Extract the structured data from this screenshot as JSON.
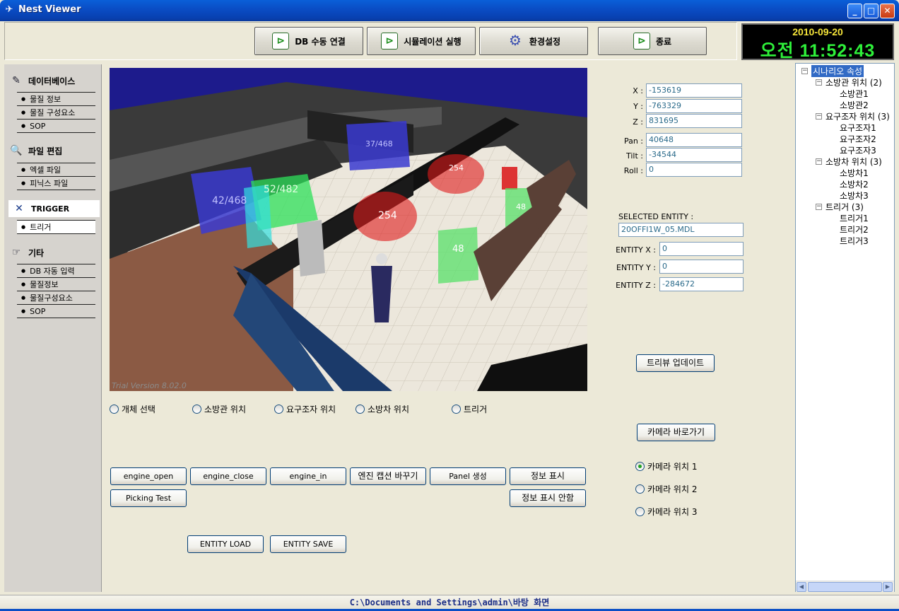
{
  "window": {
    "title": "Nest Viewer",
    "minimize": "_",
    "maximize": "□",
    "close": "✕"
  },
  "toolbar": {
    "db_connect": "DB 수동 연결",
    "run_sim": "시뮬레이션 실행",
    "settings": "환경설정",
    "exit": "종료",
    "icon_glyph": "⊳"
  },
  "clock": {
    "date": "2010-09-20",
    "time": "오전 11:52:43"
  },
  "sidebar": {
    "sections": [
      {
        "title": "데이터베이스",
        "items": [
          "물질 정보",
          "물질 구성요소",
          "SOP"
        ]
      },
      {
        "title": "파일 편집",
        "items": [
          "엑셀 파일",
          "피닉스 파일"
        ]
      },
      {
        "title": "TRIGGER",
        "items": [
          "트리거"
        ]
      },
      {
        "title": "기타",
        "items": [
          "DB 자동 입력",
          "물질정보",
          "물질구성요소",
          "SOP"
        ]
      }
    ]
  },
  "viewport": {
    "watermark": "Trial Version 8.02.0",
    "labels": [
      "42/468",
      "52/482",
      "37/468",
      "254",
      "254",
      "48",
      "48"
    ]
  },
  "radios": [
    "개체 선택",
    "소방관 위치",
    "요구조자 위치",
    "소방차 위치",
    "트리거"
  ],
  "buttons": {
    "engine_open": "engine_open",
    "engine_close": "engine_close",
    "engine_in": "engine_in",
    "engine_caption": "엔진 캡션 바꾸기",
    "panel_create": "Panel 생성",
    "info_show": "정보 표시",
    "picking_test": "Picking Test",
    "info_hide": "정보 표시 안함",
    "entity_load": "ENTITY LOAD",
    "entity_save": "ENTITY SAVE",
    "tree_update": "트리뷰 업데이트",
    "camera_go": "카메라 바로가기"
  },
  "coords": {
    "x_label": "X :",
    "x": "-153619",
    "y_label": "Y :",
    "y": "-763329",
    "z_label": "Z :",
    "z": "831695",
    "pan_label": "Pan :",
    "pan": "40648",
    "tilt_label": "Tilt :",
    "tilt": "-34544",
    "roll_label": "Roll :",
    "roll": "0"
  },
  "entity": {
    "selected_label": "SELECTED ENTITY :",
    "selected": "20OFFI1W_05.MDL",
    "x_label": "ENTITY X :",
    "x": "0",
    "y_label": "ENTITY Y :",
    "y": "0",
    "z_label": "ENTITY Z :",
    "z": "-284672"
  },
  "camera_radios": [
    "카메라 위치 1",
    "카메라 위치 2",
    "카메라 위치 3"
  ],
  "tree": {
    "root": "시나리오 속성",
    "groups": [
      {
        "label": "소방관 위치 (2)",
        "children": [
          "소방관1",
          "소방관2"
        ]
      },
      {
        "label": "요구조자 위치 (3)",
        "children": [
          "요구조자1",
          "요구조자2",
          "요구조자3"
        ]
      },
      {
        "label": "소방차 위치 (3)",
        "children": [
          "소방차1",
          "소방차2",
          "소방차3"
        ]
      },
      {
        "label": "트리거 (3)",
        "children": [
          "트리거1",
          "트리거2",
          "트리거3"
        ]
      }
    ]
  },
  "status": "C:\\Documents and Settings\\admin\\바탕 화면"
}
